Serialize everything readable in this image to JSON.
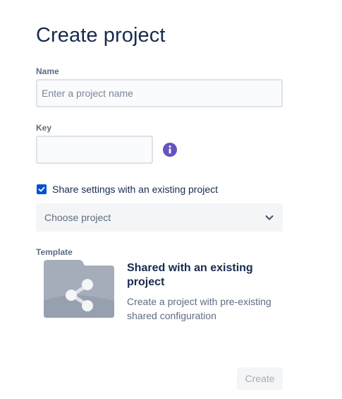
{
  "form": {
    "title": "Create project",
    "name": {
      "label": "Name",
      "value": "",
      "placeholder": "Enter a project name"
    },
    "key": {
      "label": "Key",
      "value": "",
      "info_icon": "info-icon"
    },
    "share_settings": {
      "label": "Share settings with an existing project",
      "checked": true
    },
    "project_select": {
      "value": "Choose project",
      "icon": "chevron-down-icon"
    },
    "template": {
      "label": "Template",
      "title": "Shared with an existing project",
      "description": "Create a project with pre-existing shared configuration",
      "icon": "shared-folder-icon"
    },
    "create_button": {
      "label": "Create",
      "disabled": true
    }
  },
  "colors": {
    "heading": "#172b4d",
    "muted": "#5e6c84",
    "accent": "#0052cc",
    "info": "#6554c0",
    "illustration": "#a5adba"
  }
}
